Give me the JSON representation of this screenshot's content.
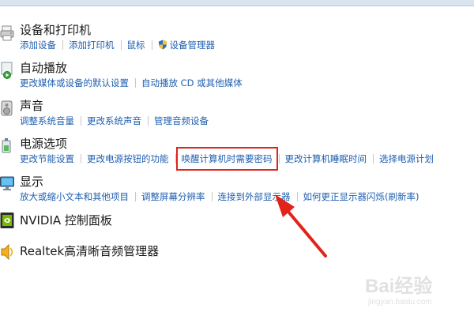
{
  "categories": [
    {
      "title": "设备和打印机",
      "icon": "printer-icon",
      "links": [
        {
          "label": "添加设备"
        },
        {
          "label": "添加打印机"
        },
        {
          "label": "鼠标"
        },
        {
          "label": "设备管理器",
          "icon": "shield-icon"
        }
      ]
    },
    {
      "title": "自动播放",
      "icon": "autoplay-icon",
      "links": [
        {
          "label": "更改媒体或设备的默认设置"
        },
        {
          "label": "自动播放 CD 或其他媒体"
        }
      ]
    },
    {
      "title": "声音",
      "icon": "speaker-icon",
      "links": [
        {
          "label": "调整系统音量"
        },
        {
          "label": "更改系统声音"
        },
        {
          "label": "管理音频设备"
        }
      ]
    },
    {
      "title": "电源选项",
      "icon": "power-options-icon",
      "links": [
        {
          "label": "更改节能设置"
        },
        {
          "label": "更改电源按钮的功能"
        },
        {
          "label": "唤醒计算机时需要密码",
          "highlighted": true
        },
        {
          "label": "更改计算机睡眠时间"
        },
        {
          "label": "选择电源计划"
        }
      ]
    },
    {
      "title": "显示",
      "icon": "display-icon",
      "links": [
        {
          "label": "放大或缩小文本和其他项目"
        },
        {
          "label": "调整屏幕分辨率"
        },
        {
          "label": "连接到外部显示器"
        },
        {
          "label": "如何更正显示器闪烁(刷新率)"
        }
      ]
    },
    {
      "title": "NVIDIA 控制面板",
      "icon": "nvidia-icon",
      "links": []
    },
    {
      "title": "Realtek高清晰音频管理器",
      "icon": "realtek-audio-icon",
      "links": []
    }
  ],
  "annotation": {
    "color": "#e2231a"
  },
  "watermark": {
    "logo": "Bai经验",
    "url": "jingyan.baidu.com"
  }
}
